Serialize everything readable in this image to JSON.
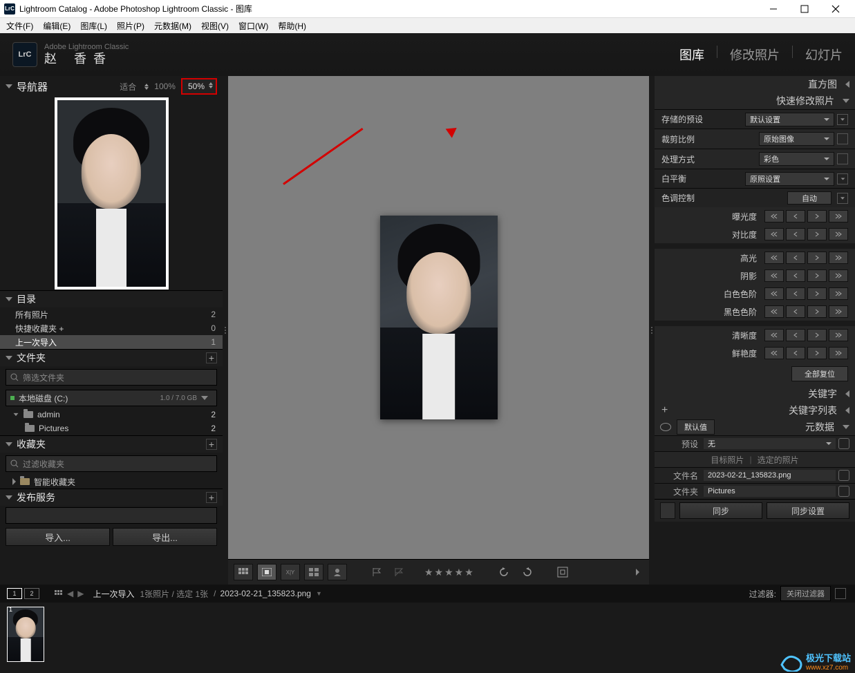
{
  "titlebar": {
    "icon_text": "LrC",
    "title": "Lightroom Catalog - Adobe Photoshop Lightroom Classic - 图库"
  },
  "menubar": [
    "文件(F)",
    "编辑(E)",
    "图库(L)",
    "照片(P)",
    "元数据(M)",
    "视图(V)",
    "窗口(W)",
    "帮助(H)"
  ],
  "identity": {
    "product": "Adobe Lightroom Classic",
    "user": "赵 香香"
  },
  "modules": {
    "library": "图库",
    "develop": "修改照片",
    "slideshow": "幻灯片"
  },
  "navigator": {
    "title": "导航器",
    "fit": "适合",
    "hundred": "100%",
    "zoom": "50%"
  },
  "catalog": {
    "title": "目录",
    "rows": [
      {
        "label": "所有照片",
        "count": "2"
      },
      {
        "label": "快捷收藏夹  +",
        "count": "0"
      },
      {
        "label": "上一次导入",
        "count": "1"
      }
    ]
  },
  "folders": {
    "title": "文件夹",
    "search_placeholder": "筛选文件夹",
    "volume": "本地磁盘 (C:)",
    "volume_usage": "1.0 / 7.0 GB",
    "tree": [
      {
        "label": "admin",
        "count": "2"
      },
      {
        "label": "Pictures",
        "count": "2"
      }
    ]
  },
  "collections": {
    "title": "收藏夹",
    "search_placeholder": "过滤收藏夹",
    "smart": "智能收藏夹"
  },
  "publish": {
    "title": "发布服务"
  },
  "bottom_left": {
    "import": "导入...",
    "export": "导出..."
  },
  "right": {
    "histogram": "直方图",
    "quick": "快速修改照片",
    "preset_label": "存储的预设",
    "preset_value": "默认设置",
    "crop_label": "裁剪比例",
    "crop_value": "原始图像",
    "treatment_label": "处理方式",
    "treatment_value": "彩色",
    "wb_label": "白平衡",
    "wb_value": "原照设置",
    "tone_label": "色调控制",
    "tone_auto": "自动",
    "sliders": [
      "曝光度",
      "对比度",
      "高光",
      "阴影",
      "白色色阶",
      "黑色色阶",
      "清晰度",
      "鲜艳度"
    ],
    "reset": "全部复位",
    "keywords": "关键字",
    "keyword_list": "关键字列表",
    "metadata_head": "元数据",
    "metadata_mode": "默认值",
    "preset2_label": "预设",
    "preset2_value": "无",
    "target_photo": "目标照片",
    "selected_photo": "选定的照片",
    "filename_k": "文件名",
    "filename_v": "2023-02-21_135823.png",
    "folder_k": "文件夹",
    "folder_v": "Pictures",
    "sync": "同步",
    "sync_settings": "同步设置"
  },
  "infobar": {
    "m1": "1",
    "m2": "2",
    "path": "上一次导入",
    "stats": "1张照片 / 选定 1张",
    "file": "2023-02-21_135823.png",
    "filter_label": "过滤器:",
    "filter_value": "关闭过滤器"
  },
  "watermark": {
    "name": "极光下载站",
    "url": "www.xz7.com"
  }
}
